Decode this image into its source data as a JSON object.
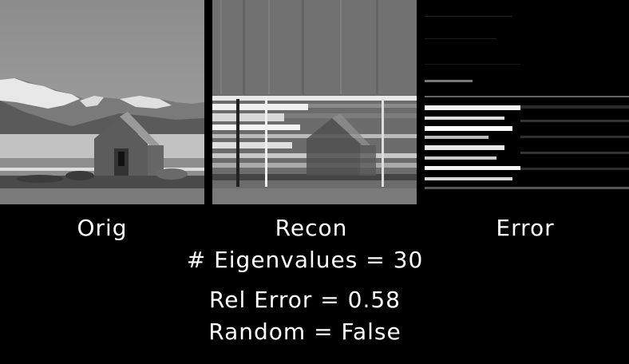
{
  "panels": {
    "orig_label": "Orig",
    "recon_label": "Recon",
    "error_label": "Error"
  },
  "stats": {
    "eigenvalues": "# Eigenvalues = 30",
    "rel_error": "Rel Error = 0.58",
    "random": "Random = False"
  }
}
